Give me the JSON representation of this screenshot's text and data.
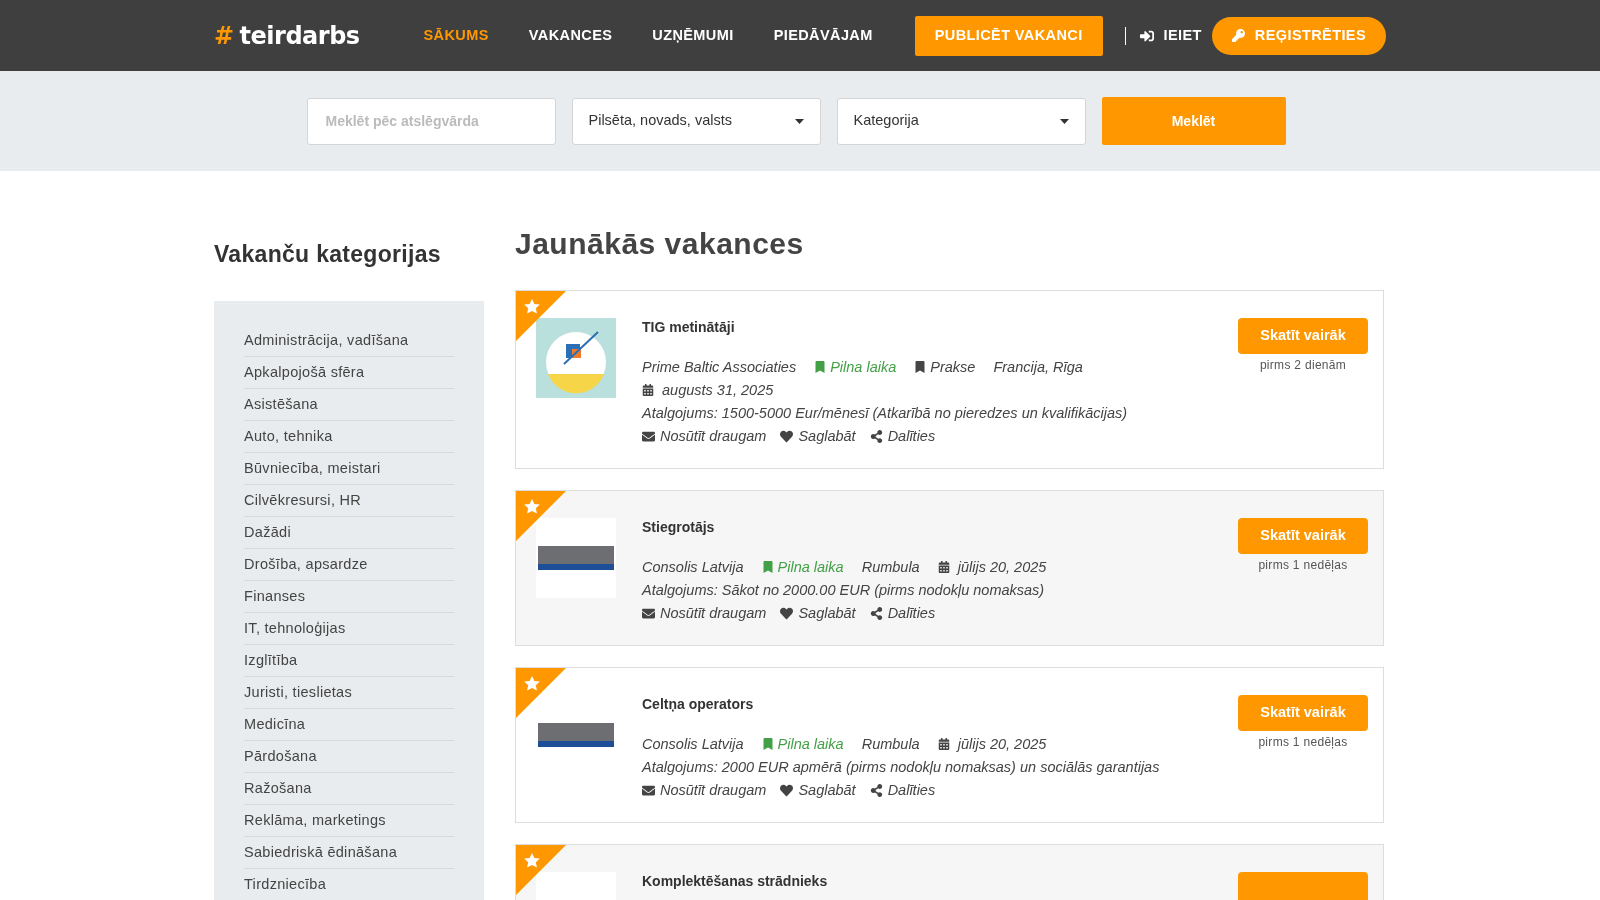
{
  "header": {
    "logo_hash": "#",
    "logo_text": "teirdarbs",
    "nav": [
      {
        "label": "SĀKUMS",
        "selected": true
      },
      {
        "label": "VAKANCES",
        "selected": false
      },
      {
        "label": "UZŅĒMUMI",
        "selected": false
      },
      {
        "label": "PIEDĀVĀJAM",
        "selected": false
      }
    ],
    "publish_button": "PUBLICĒT VAKANCI",
    "login": "IEIET",
    "register": "REĢISTRĒTIES"
  },
  "search": {
    "keyword_placeholder": "Meklēt pēc atslēgvārda",
    "location": "Pilsēta, novads, valsts",
    "category": "Kategorija",
    "button": "Meklēt"
  },
  "sidebar": {
    "title": "Vakanču kategorijas",
    "items": [
      "Administrācija, vadīšana",
      "Apkalpojošā sfēra",
      "Asistēšana",
      "Auto, tehnika",
      "Būvniecība, meistari",
      "Cilvēkresursi, HR",
      "Dažādi",
      "Drošība, apsardze",
      "Finanses",
      "IT, tehnoloģijas",
      "Izglītība",
      "Juristi, tieslietas",
      "Medicīna",
      "Pārdošana",
      "Ražošana",
      "Reklāma, marketings",
      "Sabiedriskā ēdināšana",
      "Tirdzniecība"
    ]
  },
  "main": {
    "title": "Jaunākās vakances",
    "jobs": [
      {
        "title": "TIG metinātāji",
        "kind": "prime",
        "meta": [
          {
            "kind": "company",
            "text": "Prime Baltic Associaties"
          },
          {
            "kind": "employment",
            "text": "Pilna laika",
            "color": "#43a047"
          },
          {
            "kind": "employment",
            "text": "Prakse",
            "color": "#444444"
          },
          {
            "kind": "location",
            "text": "Francija, Rīga"
          },
          {
            "kind": "date",
            "text": "augusts 31, 2025"
          },
          {
            "kind": "salary",
            "text": "Atalgojums: 1500-5000 Eur/mēnesī (Atkarībā no pieredzes un kvalifikācijas)"
          }
        ],
        "actions": [
          "Nosūtīt draugam",
          "Saglabāt",
          "Dalīties"
        ],
        "button": "Skatīt vairāk",
        "posted": "pirms 2 dienām"
      },
      {
        "title": "Stiegrotājs",
        "kind": "consolis",
        "meta": [
          {
            "kind": "company",
            "text": "Consolis Latvija"
          },
          {
            "kind": "employment",
            "text": "Pilna laika",
            "color": "#43a047"
          },
          {
            "kind": "location",
            "text": "Rumbula"
          },
          {
            "kind": "date",
            "text": "jūlijs 20, 2025"
          },
          {
            "kind": "salary",
            "text": "Atalgojums: Sākot no 2000.00 EUR (pirms nodokļu nomaksas)"
          }
        ],
        "actions": [
          "Nosūtīt draugam",
          "Saglabāt",
          "Dalīties"
        ],
        "button": "Skatīt vairāk",
        "posted": "pirms 1 nedēļas"
      },
      {
        "title": "Celtņa operators",
        "kind": "consolis",
        "meta": [
          {
            "kind": "company",
            "text": "Consolis Latvija"
          },
          {
            "kind": "employment",
            "text": "Pilna laika",
            "color": "#43a047"
          },
          {
            "kind": "location",
            "text": "Rumbula"
          },
          {
            "kind": "date",
            "text": "jūlijs 20, 2025"
          },
          {
            "kind": "salary",
            "text": "Atalgojums: 2000 EUR apmērā (pirms nodokļu nomaksas) un sociālās garantijas"
          }
        ],
        "actions": [
          "Nosūtīt draugam",
          "Saglabāt",
          "Dalīties"
        ],
        "button": "Skatīt vairāk",
        "posted": "pirms 1 nedēļas"
      },
      {
        "title": "Komplektēšanas strādnieks",
        "kind": "blank"
      }
    ]
  }
}
